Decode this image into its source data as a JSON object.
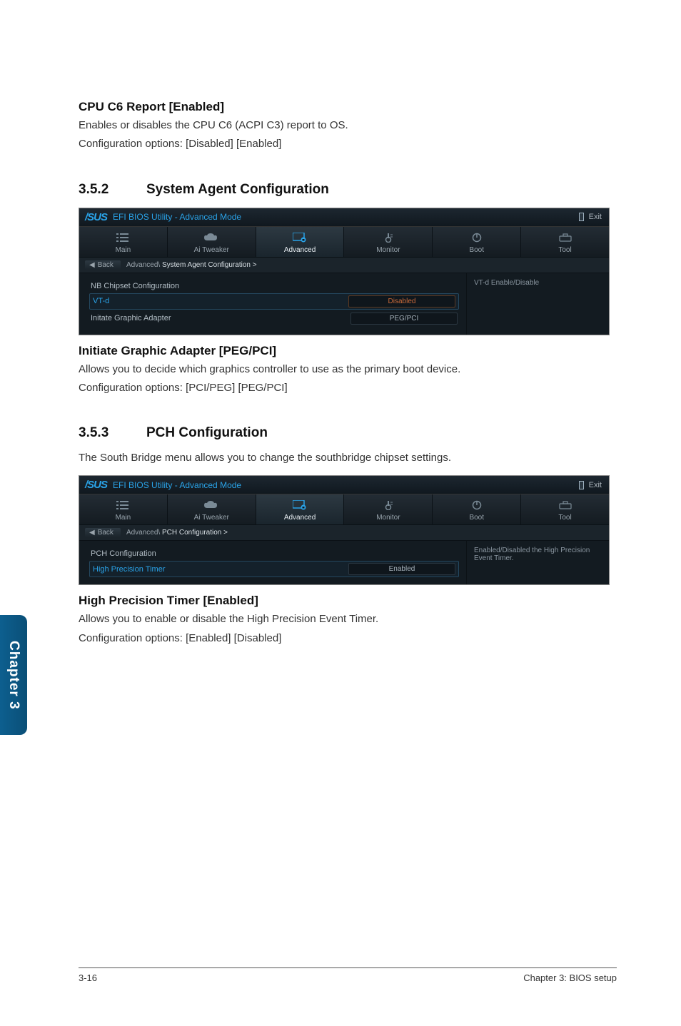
{
  "cpu_c6": {
    "heading": "CPU C6 Report [Enabled]",
    "line1": "Enables or disables the CPU C6 (ACPI C3) report to OS.",
    "line2": "Configuration options: [Disabled] [Enabled]"
  },
  "sec_352": {
    "num": "3.5.2",
    "title": "System Agent Configuration"
  },
  "bios1": {
    "brand": "/SUS",
    "title": "EFI BIOS Utility - Advanced Mode",
    "exit": "Exit",
    "tabs": {
      "main": "Main",
      "tweaker": "Ai  Tweaker",
      "advanced": "Advanced",
      "monitor": "Monitor",
      "boot": "Boot",
      "tool": "Tool"
    },
    "crumb_back": "Back",
    "crumb_path": "Advanced\\",
    "crumb_strong": "System Agent Configuration  >",
    "rows": {
      "nbchipset": "NB Chipset Configuration",
      "vtd": "VT-d",
      "vtd_val": "Disabled",
      "iga": "Initate Graphic Adapter",
      "iga_val": "PEG/PCI"
    },
    "help": "VT-d Enable/Disable"
  },
  "iga": {
    "heading": "Initiate Graphic Adapter [PEG/PCI]",
    "line1": "Allows you to decide which graphics controller to use as the primary boot device.",
    "line2": "Configuration options: [PCI/PEG] [PEG/PCI]"
  },
  "sec_353": {
    "num": "3.5.3",
    "title": "PCH Configuration"
  },
  "pch_intro": "The South Bridge menu allows you to change the southbridge chipset settings.",
  "bios2": {
    "brand": "/SUS",
    "title": "EFI BIOS Utility - Advanced Mode",
    "exit": "Exit",
    "tabs": {
      "main": "Main",
      "tweaker": "Ai  Tweaker",
      "advanced": "Advanced",
      "monitor": "Monitor",
      "boot": "Boot",
      "tool": "Tool"
    },
    "crumb_back": "Back",
    "crumb_path": "Advanced\\",
    "crumb_strong": "PCH Configuration  >",
    "rows": {
      "pchconf": "PCH Configuration",
      "hpt": "High Precision Timer",
      "hpt_val": "Enabled"
    },
    "help": "Enabled/Disabled the High Precision Event Timer."
  },
  "hpt": {
    "heading": "High Precision Timer [Enabled]",
    "line1": "Allows you to enable or disable the High Precision Event Timer.",
    "line2": "Configuration options: [Enabled] [Disabled]"
  },
  "sidetab": "Chapter 3",
  "footer_left": "3-16",
  "footer_right": "Chapter 3: BIOS setup"
}
